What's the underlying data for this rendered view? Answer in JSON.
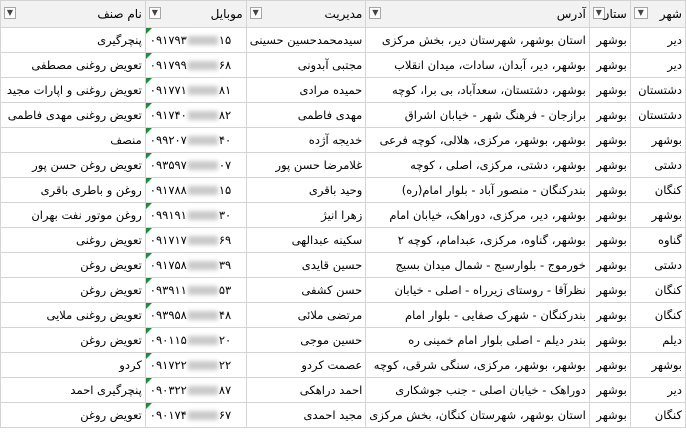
{
  "headers": {
    "city": "شهر",
    "province": "ستان",
    "address": "آدرس",
    "manager": "مدیریت",
    "mobile": "موبایل",
    "business_type": "نام صنف"
  },
  "icons": {
    "filter": "dropdown-filter-icon",
    "filter_active": "funnel-filter-icon",
    "comment_marker": "green-triangle-icon"
  },
  "rows": [
    {
      "city": "دیر",
      "province": "بوشهر",
      "address": "استان بوشهر، شهرستان دیر، بخش مرکزی",
      "manager": "سیدمحمدحسین حسینی",
      "mobile_prefix": "۰۹۱۷۹۳",
      "mobile_suffix": "۱۵",
      "type": "پنچرگیری"
    },
    {
      "city": "دیر",
      "province": "بوشهر",
      "address": "بوشهر، دیر، آبدان، سادات، میدان انقلاب",
      "manager": "مجتبی آبدونی",
      "mobile_prefix": "۰۹۱۷۹۹",
      "mobile_suffix": "۶۸",
      "type": "تعویض روغنی  مصطفی"
    },
    {
      "city": "دشتستان",
      "province": "بوشهر",
      "address": "بوشهر، دشتستان، سعدآباد، بی برا، کوچه",
      "manager": "حمیده مرادی",
      "mobile_prefix": "۰۹۱۷۷۱",
      "mobile_suffix": "۸۱",
      "type": "تعویض روغنی و اپارات مجید"
    },
    {
      "city": "دشتستان",
      "province": "بوشهر",
      "address": "برازجان - فرهنگ شهر - خیابان اشراق",
      "manager": "مهدی فاطمی",
      "mobile_prefix": "۰۹۱۷۴۰",
      "mobile_suffix": "۸۲",
      "type": "تعویض روغنی مهدی فاطمی"
    },
    {
      "city": "بوشهر",
      "province": "بوشهر",
      "address": "بوشهر، بوشهر، مرکزی، هلالی، کوچه فرعی",
      "manager": "خدیجه آژده",
      "mobile_prefix": "۰۹۹۲۰۷",
      "mobile_suffix": "۴۰",
      "type": "منصف"
    },
    {
      "city": "دشتی",
      "province": "بوشهر",
      "address": "بوشهر، دشتی، مرکزی، اصلی ، کوچه",
      "manager": "غلامرضا حسن پور",
      "mobile_prefix": "۰۹۳۵۹۷",
      "mobile_suffix": "۰۷",
      "type": "تعویض روغن حسن پور"
    },
    {
      "city": "کنگان",
      "province": "بوشهر",
      "address": "بندرکنگان - منصور آباد - بلوار امام(ره)",
      "manager": "وحید باقری",
      "mobile_prefix": "۰۹۱۷۸۸",
      "mobile_suffix": "۱۵",
      "type": "روغن و باطری باقری"
    },
    {
      "city": "بوشهر",
      "province": "بوشهر",
      "address": "بوشهر، دیر، مرکزی، دوراهک، خیابان امام",
      "manager": "زهرا انیژ",
      "mobile_prefix": "۰۹۹۱۹۱",
      "mobile_suffix": "۳۰",
      "type": "روغن موتور نفت بهران"
    },
    {
      "city": "گناوه",
      "province": "بوشهر",
      "address": "بوشهر، گناوه، مرکزی، عبدامام، کوچه ۲",
      "manager": "سکینه عبدالهی",
      "mobile_prefix": "۰۹۱۷۱۷",
      "mobile_suffix": "۶۹",
      "type": "تعویض روغنی"
    },
    {
      "city": "دشتی",
      "province": "بوشهر",
      "address": "خورموج - بلوارسبج - شمال میدان بسیج",
      "manager": "حسین قایدی",
      "mobile_prefix": "۰۹۱۷۵۸",
      "mobile_suffix": "۳۹",
      "type": "تعویض روغن"
    },
    {
      "city": "کنگان",
      "province": "بوشهر",
      "address": "نظرآقا - روستای زیرراه - اصلی - خیابان",
      "manager": "حسن کشفی",
      "mobile_prefix": "۰۹۳۹۱۱",
      "mobile_suffix": "۵۳",
      "type": "تعویض روغن"
    },
    {
      "city": "کنگان",
      "province": "بوشهر",
      "address": "بندرکنگان - شهرک صفایی - بلوار امام",
      "manager": "مرتضی ملائی",
      "mobile_prefix": "۰۹۳۹۵۸",
      "mobile_suffix": "۴۸",
      "type": "تعویض روغنی ملایی"
    },
    {
      "city": "دیلم",
      "province": "بوشهر",
      "address": "بندر دیلم - اصلی بلوار امام خمینی ره",
      "manager": "حسین موجی",
      "mobile_prefix": "۰۹۰۱۱۵",
      "mobile_suffix": "۲۰",
      "type": "تعویض روغن"
    },
    {
      "city": "بوشهر",
      "province": "بوشهر",
      "address": "بوشهر، بوشهر، مرکزی، سنگی شرقی، کوچه",
      "manager": "عصمت کردو",
      "mobile_prefix": "۰۹۱۷۲۲",
      "mobile_suffix": "۲۲",
      "type": "کردو"
    },
    {
      "city": "دیر",
      "province": "بوشهر",
      "address": "دوراهک - خیابان اصلی - جنب جوشکاری",
      "manager": "احمد دراهکی",
      "mobile_prefix": "۰۹۰۳۲۲",
      "mobile_suffix": "۸۷",
      "type": "پنچرگیری احمد"
    },
    {
      "city": "کنگان",
      "province": "بوشهر",
      "address": "استان بوشهر، شهرستان کنگان، بخش مرکزی",
      "manager": "مجید احمدی",
      "mobile_prefix": "۰۹۰۱۷۴",
      "mobile_suffix": "۶۷",
      "type": "تعویض روغن"
    }
  ]
}
